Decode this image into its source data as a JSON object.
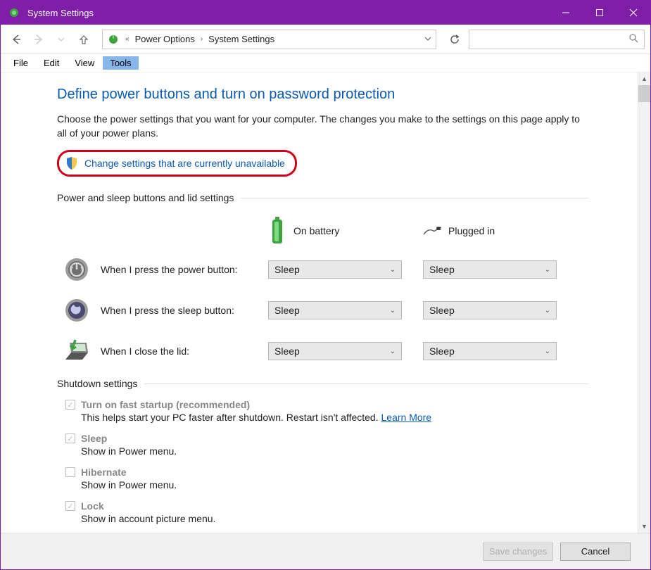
{
  "titlebar": {
    "title": "System Settings"
  },
  "nav": {
    "breadcrumb_prefix": "«",
    "breadcrumb": [
      "Power Options",
      "System Settings"
    ]
  },
  "menus": {
    "file": "File",
    "edit": "Edit",
    "view": "View",
    "tools": "Tools"
  },
  "page": {
    "heading": "Define power buttons and turn on password protection",
    "description": "Choose the power settings that you want for your computer. The changes you make to the settings on this page apply to all of your power plans.",
    "change_settings": "Change settings that are currently unavailable"
  },
  "sections": {
    "power_sleep_header": "Power and sleep buttons and lid settings",
    "shutdown_header": "Shutdown settings"
  },
  "columns": {
    "battery": "On battery",
    "plugged": "Plugged in"
  },
  "rows": {
    "power": {
      "label": "When I press the power button:",
      "battery": "Sleep",
      "plugged": "Sleep"
    },
    "sleep": {
      "label": "When I press the sleep button:",
      "battery": "Sleep",
      "plugged": "Sleep"
    },
    "lid": {
      "label": "When I close the lid:",
      "battery": "Sleep",
      "plugged": "Sleep"
    }
  },
  "shutdown": {
    "faststartup": {
      "title": "Turn on fast startup (recommended)",
      "desc": "This helps start your PC faster after shutdown. Restart isn't affected. ",
      "link": "Learn More",
      "checked": true
    },
    "sleep": {
      "title": "Sleep",
      "desc": "Show in Power menu.",
      "checked": true
    },
    "hibernate": {
      "title": "Hibernate",
      "desc": "Show in Power menu.",
      "checked": false
    },
    "lock": {
      "title": "Lock",
      "desc": "Show in account picture menu.",
      "checked": true
    }
  },
  "buttons": {
    "save": "Save changes",
    "cancel": "Cancel"
  }
}
